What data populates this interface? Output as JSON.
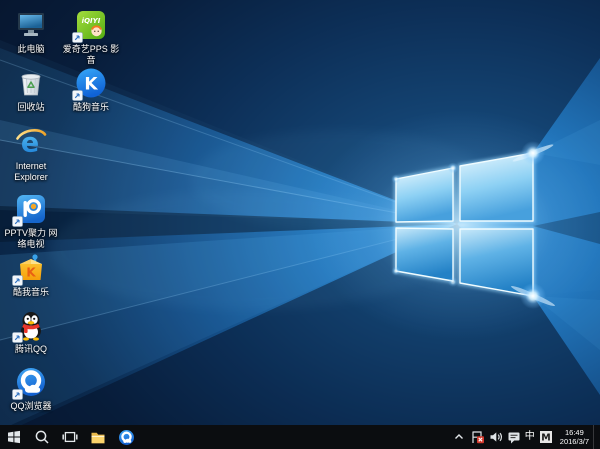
{
  "wallpaper": {
    "name": "Windows 10 Hero",
    "base_color": "#0a1c33",
    "beam_color": "#5ab4f0",
    "logo_edge_color": "#f0fcff"
  },
  "desktop": {
    "icons": [
      {
        "name": "this-pc",
        "label": "此电脑",
        "shortcut": false
      },
      {
        "name": "iqiyi-pps",
        "label": "爱奇艺PPS 影音",
        "shortcut": true
      },
      {
        "name": "recycle-bin",
        "label": "回收站",
        "shortcut": false
      },
      {
        "name": "kugou-music",
        "label": "酷狗音乐",
        "shortcut": true
      },
      {
        "name": "internet-explorer",
        "label": "Internet Explorer",
        "shortcut": false
      },
      {
        "name": "pptv",
        "label": "PPTV聚力 网络电视",
        "shortcut": true
      },
      {
        "name": "kuwo-music",
        "label": "酷我音乐",
        "shortcut": true
      },
      {
        "name": "tencent-qq",
        "label": "腾讯QQ",
        "shortcut": true
      },
      {
        "name": "qq-browser",
        "label": "QQ浏览器",
        "shortcut": true
      }
    ]
  },
  "glyphs": {
    "iqiyi": "iQIYI",
    "kugou": "K",
    "kuwo": "K",
    "ie": "e"
  },
  "taskbar": {
    "buttons": [
      "start",
      "search",
      "task-view",
      "file-explorer",
      "qq-browser"
    ]
  },
  "tray": {
    "ime_lang": "中",
    "ime_brand": "M",
    "time": "16:49",
    "date": "2016/3/7"
  }
}
